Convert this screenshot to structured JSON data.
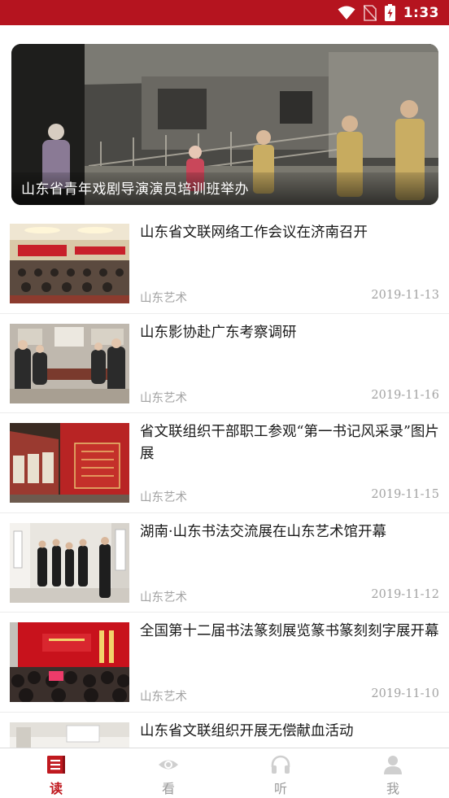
{
  "status_bar": {
    "time": "1:33",
    "icons": [
      "wifi-icon",
      "no-sim-icon",
      "battery-charging-icon"
    ]
  },
  "colors": {
    "brand_red": "#b5141f",
    "active_tab": "#c0191f",
    "meta_gray": "#a3a3a3"
  },
  "banner": {
    "caption": "山东省青年戏剧导演演员培训班举办"
  },
  "news": [
    {
      "title": "山东省文联网络工作会议在济南召开",
      "source": "山东艺术",
      "date": "2019-11-13"
    },
    {
      "title": "山东影协赴广东考察调研",
      "source": "山东艺术",
      "date": "2019-11-16"
    },
    {
      "title": "省文联组织干部职工参观“第一书记风采录”图片展",
      "source": "山东艺术",
      "date": "2019-11-15"
    },
    {
      "title": "湖南·山东书法交流展在山东艺术馆开幕",
      "source": "山东艺术",
      "date": "2019-11-12"
    },
    {
      "title": "全国第十二届书法篆刻展览篆书篆刻刻字展开幕",
      "source": "山东艺术",
      "date": "2019-11-10"
    },
    {
      "title": "山东省文联组织开展无偿献血活动",
      "source": "",
      "date": ""
    }
  ],
  "bottom_nav": {
    "tabs": [
      {
        "label": "读",
        "icon": "book-icon",
        "active": true
      },
      {
        "label": "看",
        "icon": "eye-icon",
        "active": false
      },
      {
        "label": "听",
        "icon": "headphones-icon",
        "active": false
      },
      {
        "label": "我",
        "icon": "person-icon",
        "active": false
      }
    ]
  }
}
